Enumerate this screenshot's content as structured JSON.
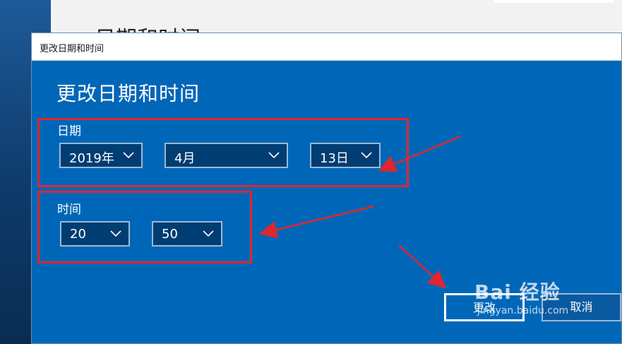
{
  "background": {
    "title": "日期和时间"
  },
  "dialog": {
    "window_title": "更改日期和时间",
    "heading": "更改日期和时间",
    "date_label": "日期",
    "time_label": "时间",
    "year": "2019年",
    "month": "4月",
    "day": "13日",
    "hour": "20",
    "minute": "50",
    "change_button": "更改",
    "cancel_button": "取消"
  },
  "watermark": {
    "brand": "Bai 经验",
    "url": "jingyan.baidu.com"
  },
  "colors": {
    "dialog_bg": "#0067b8",
    "select_bg": "#003d73",
    "annotation_red": "#e0262e"
  }
}
